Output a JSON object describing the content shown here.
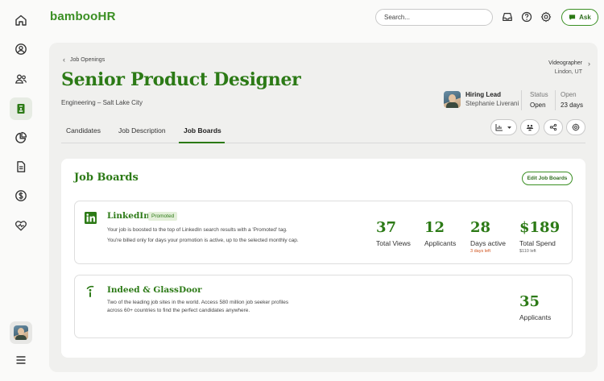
{
  "brand": {
    "logo_text": "bambooHR",
    "accent": "#2c7a16"
  },
  "topbar": {
    "search_placeholder": "Search...",
    "icons": [
      "inbox-icon",
      "help-icon",
      "settings-icon"
    ],
    "ask_label": "Ask"
  },
  "sidebar": {
    "items": [
      "home-icon",
      "person-circle-icon",
      "people-icon",
      "clipboard-icon",
      "pie-chart-icon",
      "document-icon",
      "dollar-icon",
      "heart-icon"
    ],
    "active_index": 3
  },
  "header": {
    "breadcrumb": "Job Openings",
    "next": {
      "title": "Videographer",
      "location": "Lindon, UT"
    },
    "title": "Senior Product Designer",
    "subtitle": "Engineering – Salt Lake City",
    "hiring_lead": {
      "label": "Hiring Lead",
      "name": "Stephanie Liverani"
    },
    "status": {
      "label": "Status",
      "value": "Open"
    },
    "open": {
      "label": "Open",
      "value": "23 days"
    }
  },
  "tabs": [
    {
      "label": "Candidates"
    },
    {
      "label": "Job Description"
    },
    {
      "label": "Job Boards",
      "active": true
    }
  ],
  "card": {
    "title": "Job Boards",
    "edit_label": "Edit Job Boards",
    "boards": [
      {
        "name": "LinkedIn",
        "badge": "Promoted",
        "desc1": "Your job is boosted to the top of LinkedIn search results with a 'Promoted' tag.",
        "desc2": "You're billed only for days your promotion is active, up to the selected monthly cap.",
        "metrics": [
          {
            "value": "37",
            "label": "Total Views"
          },
          {
            "value": "12",
            "label": "Applicants"
          },
          {
            "value": "28",
            "label": "Days active",
            "sub": "3 days left",
            "sub_color": "#d0541f"
          },
          {
            "value": "$189",
            "label": "Total Spend",
            "sub": "$110 left",
            "sub_color": "#666666"
          }
        ]
      },
      {
        "name": "Indeed & GlassDoor",
        "desc1": "Two of the leading job sites in the world. Access 580 million job seeker profiles",
        "desc2": "across 60+ countries to find the perfect candidates anywhere.",
        "metrics": [
          {
            "value": "35",
            "label": "Applicants"
          }
        ]
      }
    ]
  }
}
